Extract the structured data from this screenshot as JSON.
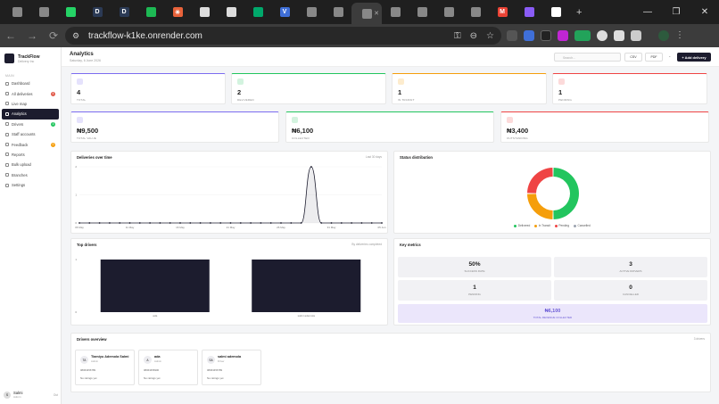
{
  "browser": {
    "url": "trackflow-k1ke.onrender.com",
    "new_tab_label": "+",
    "tabs": [
      {
        "icon": "globe-icon",
        "color": "#888888",
        "text": ""
      },
      {
        "icon": "globe-icon",
        "color": "#888888",
        "text": ""
      },
      {
        "icon": "whatsapp-icon",
        "color": "#25d366",
        "text": ""
      },
      {
        "icon": "d-icon",
        "color": "#2b3a55",
        "text": "D"
      },
      {
        "icon": "d-icon",
        "color": "#2b3a55",
        "text": "D"
      },
      {
        "icon": "spotify-icon",
        "color": "#1db954",
        "text": ""
      },
      {
        "icon": "asterisk-icon",
        "color": "#e8623a",
        "text": "✳"
      },
      {
        "icon": "puzzle-icon",
        "color": "#dddddd",
        "text": ""
      },
      {
        "icon": "openai-icon",
        "color": "#dddddd",
        "text": ""
      },
      {
        "icon": "leaf-icon",
        "color": "#00a86b",
        "text": ""
      },
      {
        "icon": "v-icon",
        "color": "#3f6fd8",
        "text": "V"
      },
      {
        "icon": "globe-icon",
        "color": "#888888",
        "text": ""
      },
      {
        "icon": "globe-icon",
        "color": "#888888",
        "text": ""
      },
      {
        "icon": "globe-icon",
        "color": "#888888",
        "text": ""
      },
      {
        "icon": "globe-icon",
        "color": "#888888",
        "text": ""
      },
      {
        "icon": "history-icon",
        "color": "#888888",
        "text": ""
      },
      {
        "icon": "history-icon",
        "color": "#888888",
        "text": ""
      },
      {
        "icon": "globe-icon",
        "color": "#888888",
        "text": ""
      },
      {
        "icon": "gmail-icon",
        "color": "#ea4335",
        "text": "M"
      },
      {
        "icon": "flower-icon",
        "color": "#8a5cf6",
        "text": ""
      },
      {
        "icon": "github-icon",
        "color": "#ffffff",
        "text": ""
      }
    ]
  },
  "app": {
    "brand": {
      "name": "TrackFlow",
      "sub": "Delivery Inc"
    },
    "nav_section": "MAIN",
    "nav": [
      {
        "label": "Dashboard",
        "badge": "",
        "badge_color": ""
      },
      {
        "label": "All deliveries",
        "badge": "4",
        "badge_color": "#e05a4a"
      },
      {
        "label": "Live map",
        "badge": "",
        "badge_color": ""
      },
      {
        "label": "Analytics",
        "badge": "",
        "badge_color": ""
      },
      {
        "label": "Drivers",
        "badge": "3",
        "badge_color": "#22c55e"
      },
      {
        "label": "Staff accounts",
        "badge": "",
        "badge_color": ""
      },
      {
        "label": "Feedback",
        "badge": "0",
        "badge_color": "#f59e0b"
      },
      {
        "label": "Reports",
        "badge": "",
        "badge_color": ""
      },
      {
        "label": "Bulk upload",
        "badge": "",
        "badge_color": ""
      },
      {
        "label": "Branches",
        "badge": "",
        "badge_color": ""
      },
      {
        "label": "Settings",
        "badge": "",
        "badge_color": ""
      }
    ],
    "user": {
      "initials": "S",
      "name": "Salmi",
      "role": "Admin",
      "logout": "Out"
    }
  },
  "header": {
    "title": "Analytics",
    "subtitle": "Saturday, 6 June 2026",
    "search_placeholder": "Search...",
    "csv": "CSV",
    "pdf": "PDF",
    "add": "+ Add delivery"
  },
  "stats_row1": [
    {
      "value": "4",
      "label": "TOTAL",
      "color": "#7c6cf0"
    },
    {
      "value": "2",
      "label": "DELIVERED",
      "color": "#22c55e"
    },
    {
      "value": "1",
      "label": "IN TRANSIT",
      "color": "#f59e0b"
    },
    {
      "value": "1",
      "label": "PENDING",
      "color": "#ef4444"
    }
  ],
  "stats_row2": [
    {
      "value": "₦9,500",
      "label": "TOTAL VALUE",
      "color": "#7c6cf0"
    },
    {
      "value": "₦6,100",
      "label": "COLLECTED",
      "color": "#22c55e"
    },
    {
      "value": "₦3,400",
      "label": "OUTSTANDING",
      "color": "#ef4444"
    }
  ],
  "line_panel": {
    "title": "Deliveries over time",
    "subtitle": "Last 30 days"
  },
  "status_panel": {
    "title": "Status distribution"
  },
  "drivers_panel": {
    "title": "Top drivers",
    "subtitle": "By deliveries completed"
  },
  "metrics_panel": {
    "title": "Key metrics",
    "items": [
      {
        "value": "50%",
        "label": "SUCCESS RATE"
      },
      {
        "value": "3",
        "label": "ACTIVE DRIVERS"
      },
      {
        "value": "1",
        "label": "PENDING"
      },
      {
        "value": "0",
        "label": "CANCELLED"
      }
    ],
    "revenue": {
      "value": "₦6,100",
      "label": "TOTAL REVENUE COLLECTED"
    }
  },
  "drivers_overview": {
    "title": "Drivers overview",
    "count": "3 drivers",
    "cards": [
      {
        "initials": "TA",
        "name": "Tiamiyu Ademola Salmi",
        "role": "Admin",
        "phone": "08063456789",
        "rating": "No ratings yet"
      },
      {
        "initials": "A",
        "name": "ada",
        "role": "Admin",
        "phone": "08063456900",
        "rating": "No ratings yet"
      },
      {
        "initials": "SA",
        "name": "salmi ademola",
        "role": "Driver",
        "phone": "08063456789",
        "rating": "No ratings yet"
      }
    ]
  },
  "chart_data": [
    {
      "type": "line",
      "title": "Deliveries over time",
      "x": [
        "06 May",
        "07 May",
        "08 May",
        "09 May",
        "10 May",
        "11 May",
        "12 May",
        "13 May",
        "14 May",
        "15 May",
        "16 May",
        "17 May",
        "18 May",
        "19 May",
        "20 May",
        "21 May",
        "22 May",
        "23 May",
        "24 May",
        "25 May",
        "26 May",
        "27 May",
        "28 May",
        "29 May",
        "30 May",
        "31 May",
        "01 Jun",
        "02 Jun",
        "03 Jun",
        "04 Jun",
        "05 Jun"
      ],
      "x_tick_labels": [
        "06 May",
        "11 May",
        "16 May",
        "21 May",
        "26 May",
        "31 May",
        "05 Jun"
      ],
      "values": [
        0,
        0,
        0,
        0,
        0,
        0,
        0,
        0,
        0,
        0,
        0,
        0,
        0,
        0,
        0,
        0,
        0,
        0,
        0,
        0,
        0,
        0,
        0,
        2,
        0,
        0,
        0,
        0,
        0,
        0,
        0
      ],
      "ylim": [
        0,
        2
      ],
      "y_ticks": [
        "0",
        "1",
        "2"
      ],
      "color": "#1c1c2e"
    },
    {
      "type": "pie",
      "title": "Status distribution",
      "donut": true,
      "slices": [
        {
          "label": "Delivered",
          "value": 2,
          "color": "#22c55e"
        },
        {
          "label": "In Transit",
          "value": 1,
          "color": "#f59e0b"
        },
        {
          "label": "Pending",
          "value": 1,
          "color": "#ef4444"
        },
        {
          "label": "Cancelled",
          "value": 0,
          "color": "#9ca3af"
        }
      ]
    },
    {
      "type": "bar",
      "title": "Top drivers",
      "categories": [
        "ada",
        "salmi ademola"
      ],
      "values": [
        1,
        1
      ],
      "ylim": [
        0,
        1
      ],
      "y_ticks": [
        "0",
        "1"
      ],
      "color": "#1c1c2e"
    }
  ]
}
